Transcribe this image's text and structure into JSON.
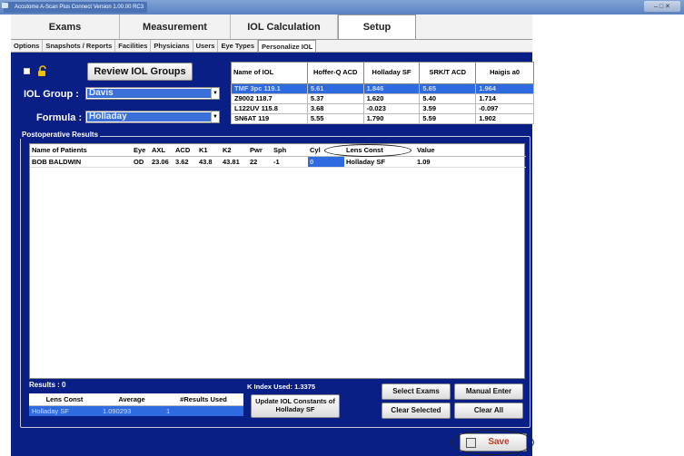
{
  "window": {
    "title": "Accutome A-Scan Plus Connect Version 1.00.00 RC3",
    "controls": "– □ ✕"
  },
  "main_tabs": [
    "Exams",
    "Measurement",
    "IOL Calculation",
    "Setup"
  ],
  "active_main_tab": "Setup",
  "sub_tabs": [
    "Options",
    "Snapshots / Reports",
    "Facilities",
    "Physicians",
    "Users",
    "Eye Types",
    "Personalize IOL"
  ],
  "active_sub_tab": "Personalize IOL",
  "controls": {
    "review_button": "Review IOL Groups",
    "iol_group_label": "IOL Group :",
    "iol_group_value": "Davis",
    "formula_label": "Formula :",
    "formula_value": "Holladay"
  },
  "iol_table": {
    "headers": [
      "Name of IOL",
      "Hoffer-Q ACD",
      "Holladay SF",
      "SRK/T ACD",
      "Haigis a0"
    ],
    "rows": [
      [
        "TMF 3pc 119.1",
        "5.61",
        "1.846",
        "5.65",
        "1.964"
      ],
      [
        "Z9002 118.7",
        "5.37",
        "1.620",
        "5.40",
        "1.714"
      ],
      [
        "L122UV 115.8",
        "3.68",
        "-0.023",
        "3.59",
        "-0.097"
      ],
      [
        "SN6AT 119",
        "5.55",
        "1.790",
        "5.59",
        "1.902"
      ]
    ],
    "selected_row": 0
  },
  "postop": {
    "title": "Postoperative Results",
    "headers": [
      "Name of Patients",
      "Eye",
      "AXL",
      "ACD",
      "K1",
      "K2",
      "Pwr",
      "Sph",
      "Cyl",
      "Lens Const",
      "Value"
    ],
    "rows": [
      [
        "BOB BALDWIN",
        "OD",
        "23.06",
        "3.62",
        "43.8",
        "43.81",
        "22",
        "-1",
        "0",
        "Holladay SF",
        "1.09"
      ]
    ]
  },
  "results": {
    "count_label": "Results : 0",
    "headers": [
      "Lens Const",
      "Average",
      "#Results Used"
    ],
    "row": [
      "Holladay SF",
      "1.090293",
      "1"
    ]
  },
  "k_index": "K Index Used: 1.3375",
  "buttons": {
    "update": "Update IOL Constants of Holladay SF",
    "select_exams": "Select Exams",
    "manual_enter": "Manual Enter",
    "clear_selected": "Clear Selected",
    "clear_all": "Clear All",
    "save": "Save"
  }
}
